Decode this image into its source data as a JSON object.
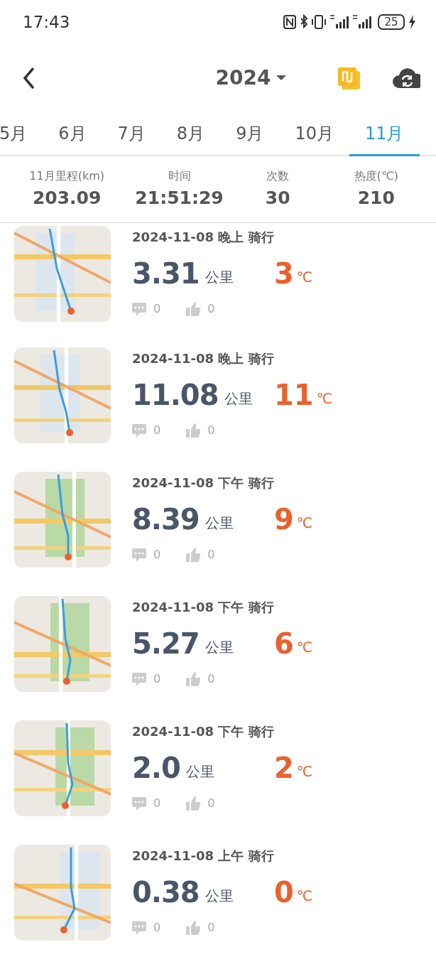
{
  "status_bar": {
    "time": "17:43",
    "battery": "25"
  },
  "header": {
    "year": "2024"
  },
  "tabs": [
    {
      "label": "5月",
      "selected": false
    },
    {
      "label": "6月",
      "selected": false
    },
    {
      "label": "7月",
      "selected": false
    },
    {
      "label": "8月",
      "selected": false
    },
    {
      "label": "9月",
      "selected": false
    },
    {
      "label": "10月",
      "selected": false
    },
    {
      "label": "11月",
      "selected": true
    }
  ],
  "stats": [
    {
      "label": "11月里程(km)",
      "value": "203.09"
    },
    {
      "label": "时间",
      "value": "21:51:29"
    },
    {
      "label": "次数",
      "value": "30"
    },
    {
      "label": "热度(℃)",
      "value": "210"
    }
  ],
  "rides": [
    {
      "title": "2024-11-08 晚上 骑行",
      "distance": "3.31",
      "distance_unit": "公里",
      "heat": "3",
      "heat_unit": "℃",
      "comments": "0",
      "likes": "0"
    },
    {
      "title": "2024-11-08 晚上 骑行",
      "distance": "11.08",
      "distance_unit": "公里",
      "heat": "11",
      "heat_unit": "℃",
      "comments": "0",
      "likes": "0"
    },
    {
      "title": "2024-11-08 下午 骑行",
      "distance": "8.39",
      "distance_unit": "公里",
      "heat": "9",
      "heat_unit": "℃",
      "comments": "0",
      "likes": "0"
    },
    {
      "title": "2024-11-08 下午 骑行",
      "distance": "5.27",
      "distance_unit": "公里",
      "heat": "6",
      "heat_unit": "℃",
      "comments": "0",
      "likes": "0"
    },
    {
      "title": "2024-11-08 下午 骑行",
      "distance": "2.0",
      "distance_unit": "公里",
      "heat": "2",
      "heat_unit": "℃",
      "comments": "0",
      "likes": "0"
    },
    {
      "title": "2024-11-08 上午 骑行",
      "distance": "0.38",
      "distance_unit": "公里",
      "heat": "0",
      "heat_unit": "℃",
      "comments": "0",
      "likes": "0"
    }
  ]
}
